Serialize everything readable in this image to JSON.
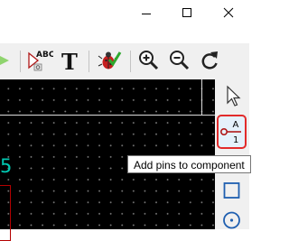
{
  "window": {
    "controls": {
      "minimize_icon": "minimize-icon",
      "maximize_icon": "maximize-icon",
      "close_icon": "close-icon"
    }
  },
  "toolbar": {
    "annotate_label": "ABC",
    "text_label": "T",
    "tools": [
      "arrow-icon",
      "annotate-icon",
      "text-icon",
      "bug-check-icon",
      "zoom-in-icon",
      "zoom-out-icon",
      "redo-icon"
    ]
  },
  "canvas": {
    "pin_number": "5",
    "colors": {
      "background": "#000000",
      "grid": "#7c7c7c",
      "pin_text": "#00c7b0",
      "body": "#b40000"
    }
  },
  "right_panel": {
    "add_pin_letter": "A",
    "add_pin_number": "1",
    "tools": [
      "select-arrow-icon",
      "add-pin-icon",
      "rectangle-icon",
      "circle-icon"
    ]
  },
  "tooltip": {
    "text": "Add pins to component"
  },
  "colors": {
    "highlight_border": "#e22b2b",
    "selected_bg": "#e5f1fb",
    "toolbar_bg": "#f0f0f0"
  }
}
